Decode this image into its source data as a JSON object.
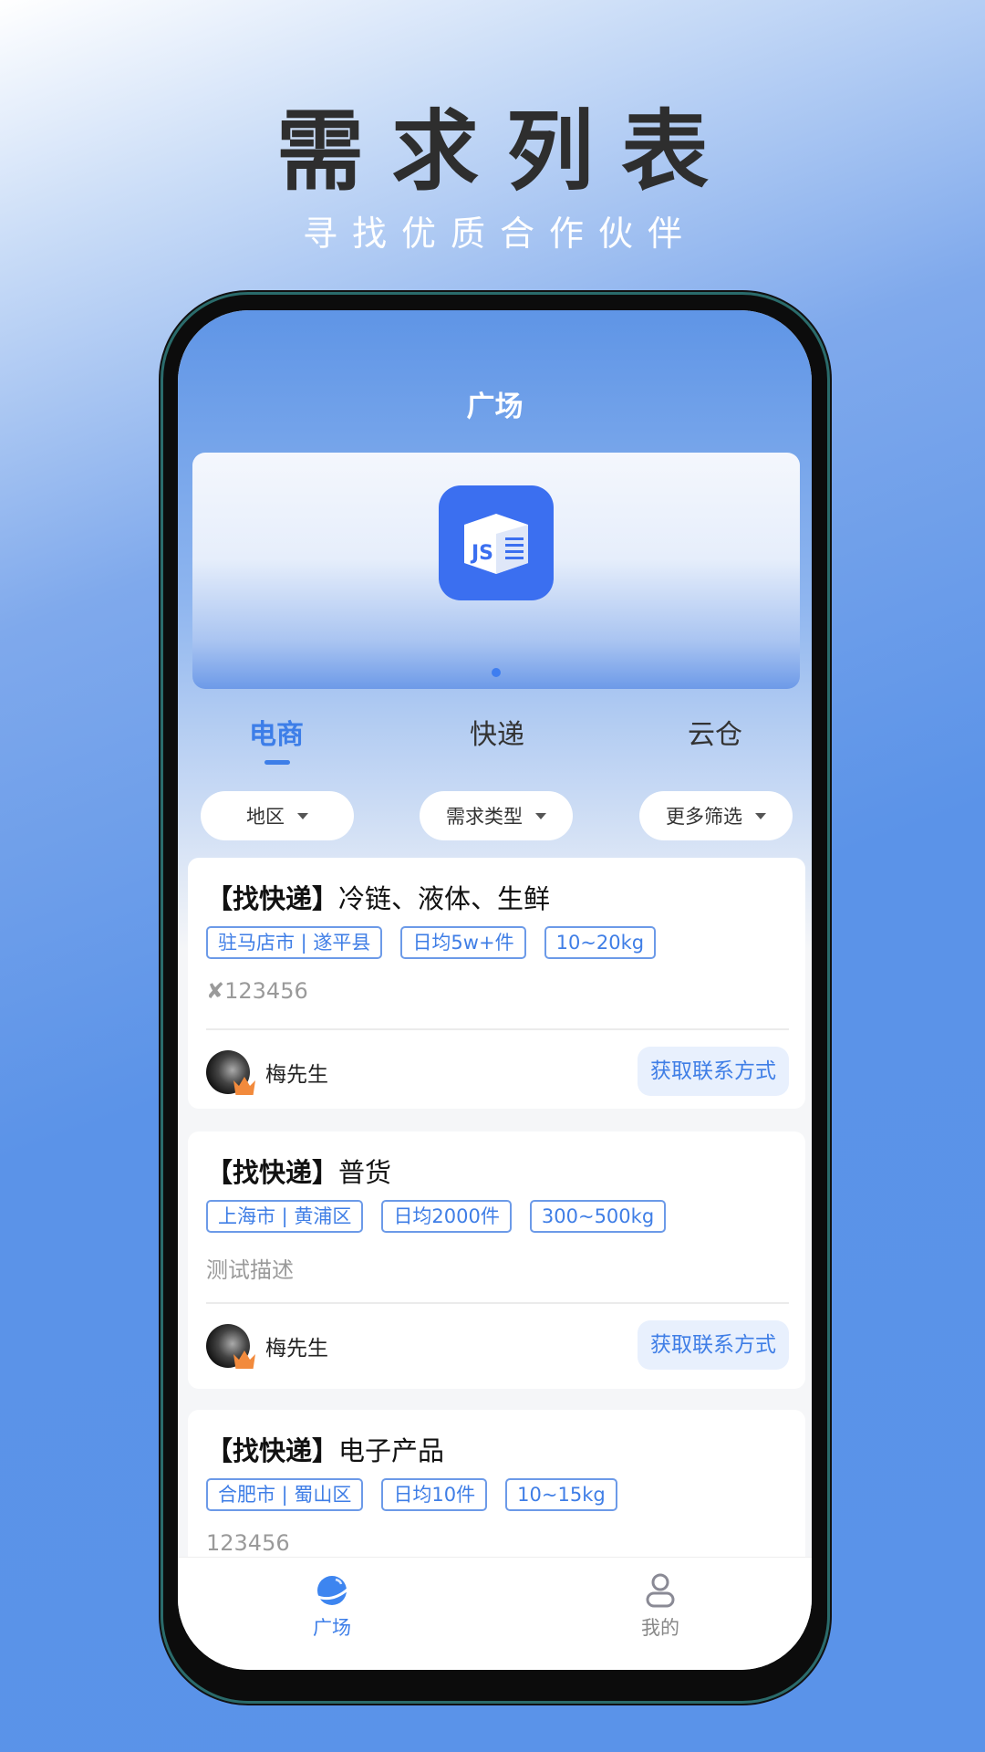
{
  "promo": {
    "title": "需求列表",
    "subtitle": "寻找优质合作伙伴"
  },
  "header": {
    "title": "广场"
  },
  "banner": {
    "logo_text": "JS",
    "active_slide": 1,
    "slide_count": 1
  },
  "tabs": [
    {
      "label": "电商",
      "active": true
    },
    {
      "label": "快递",
      "active": false
    },
    {
      "label": "云仓",
      "active": false
    }
  ],
  "filters": [
    {
      "label": "地区"
    },
    {
      "label": "需求类型"
    },
    {
      "label": "更多筛选"
    }
  ],
  "cards": [
    {
      "prefix": "【找快递】",
      "title": "冷链、液体、生鲜",
      "tags": [
        "驻马店市 | 遂平县",
        "日均5w+件",
        "10~20kg"
      ],
      "desc": "✘123456",
      "user": "梅先生",
      "action": "获取联系方式"
    },
    {
      "prefix": "【找快递】",
      "title": "普货",
      "tags": [
        "上海市 | 黄浦区",
        "日均2000件",
        "300~500kg"
      ],
      "desc": "测试描述",
      "user": "梅先生",
      "action": "获取联系方式"
    },
    {
      "prefix": "【找快递】",
      "title": "电子产品",
      "tags": [
        "合肥市 | 蜀山区",
        "日均10件",
        "10~15kg"
      ],
      "desc": "123456"
    }
  ],
  "bottom_nav": [
    {
      "label": "广场",
      "icon": "planet-icon",
      "active": true
    },
    {
      "label": "我的",
      "icon": "user-icon",
      "active": false
    }
  ],
  "colors": {
    "accent": "#3d7ee8",
    "background": "#5b93e8"
  }
}
